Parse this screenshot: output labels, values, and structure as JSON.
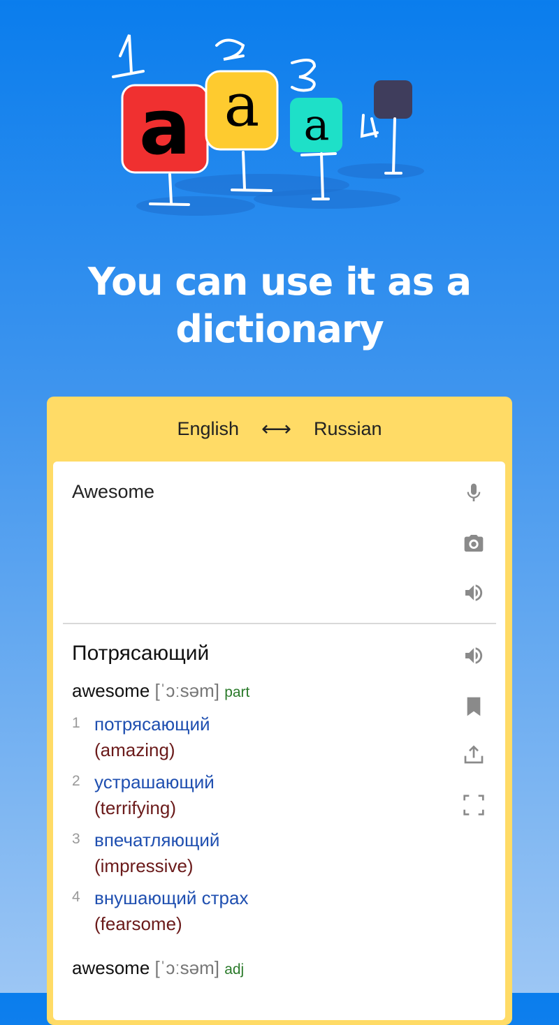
{
  "headline": "You can use it as a dictionary",
  "lang_bar": {
    "source": "English",
    "target": "Russian",
    "swap_icon": "swap-arrows-icon"
  },
  "input": {
    "value": "Awesome"
  },
  "translation": {
    "main": "Потрясающий",
    "entries": [
      {
        "word": "awesome",
        "transcription": "[ˈɔːsəm]",
        "pos": "part",
        "meanings": [
          {
            "num": "1",
            "ru": "потрясающий",
            "en": "(amazing)"
          },
          {
            "num": "2",
            "ru": "устрашающий",
            "en": "(terrifying)"
          },
          {
            "num": "3",
            "ru": "впечатляющий",
            "en": "(impressive)"
          },
          {
            "num": "4",
            "ru": "внушающий страх",
            "en": "(fearsome)"
          }
        ]
      },
      {
        "word": "awesome",
        "transcription": "[ˈɔːsəm]",
        "pos": "adj"
      }
    ]
  },
  "colors": {
    "card": "#ffdb66",
    "ru_text": "#1f4fb0",
    "en_text": "#6a1a1a",
    "pos": "#2a7a2a"
  }
}
